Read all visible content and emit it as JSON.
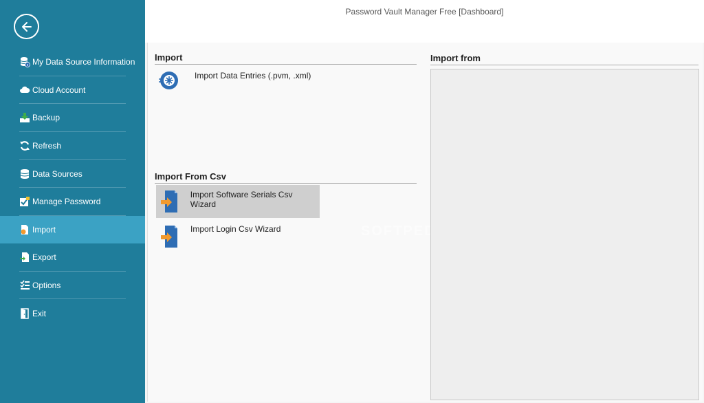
{
  "window": {
    "title": "Password Vault Manager Free [Dashboard]"
  },
  "sidebar": {
    "back_icon": "arrow-left-icon",
    "items": [
      {
        "label": "My Data Source Information",
        "icon": "database-info-icon"
      },
      {
        "label": "Cloud Account",
        "icon": "cloud-icon"
      },
      {
        "label": "Backup",
        "icon": "backup-icon"
      },
      {
        "label": "Refresh",
        "icon": "refresh-icon"
      },
      {
        "label": "Data Sources",
        "icon": "data-sources-icon"
      },
      {
        "label": "Manage Password",
        "icon": "manage-password-icon"
      },
      {
        "label": "Import",
        "icon": "import-icon",
        "active": true
      },
      {
        "label": "Export",
        "icon": "export-icon"
      },
      {
        "label": "Options",
        "icon": "options-icon"
      },
      {
        "label": "Exit",
        "icon": "exit-icon"
      }
    ]
  },
  "import_section": {
    "title": "Import",
    "entries": [
      {
        "label": "Import Data Entries (.pvm, .xml)",
        "icon": "import-data-entries-icon"
      }
    ]
  },
  "csv_section": {
    "title": "Import From Csv",
    "entries": [
      {
        "label": "Import Software Serials Csv Wizard",
        "icon": "csv-import-icon",
        "selected": true
      },
      {
        "label": "Import Login Csv Wizard",
        "icon": "csv-import-icon"
      }
    ]
  },
  "preview": {
    "title": "Import from"
  },
  "watermark": {
    "text": "SOFTPEDIA"
  },
  "colors": {
    "sidebar": "#1f7d9b",
    "active": "#3ba2c4",
    "accent_orange": "#f29a2e",
    "accent_blue": "#2e6db4"
  }
}
